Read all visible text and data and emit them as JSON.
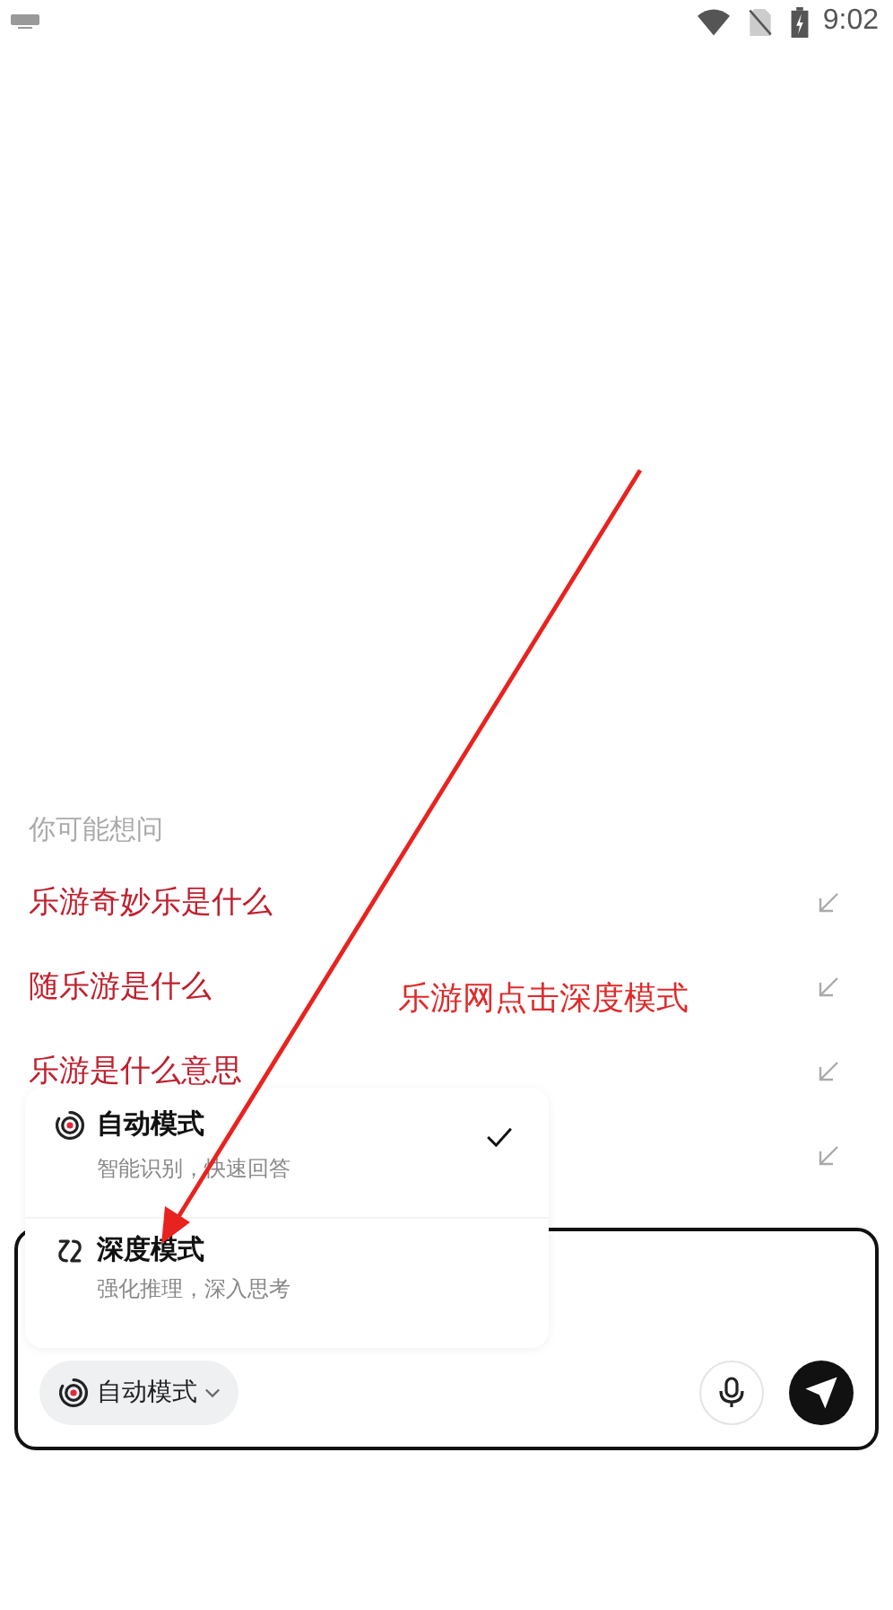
{
  "status_bar": {
    "time": "9:02"
  },
  "suggestions": {
    "title": "你可能想问",
    "items": [
      {
        "text": "乐游奇妙乐是什么"
      },
      {
        "text": "随乐游是什么"
      },
      {
        "text": "乐游是什么意思"
      }
    ]
  },
  "mode_menu": [
    {
      "kind": "auto",
      "label": "自动模式",
      "description": "智能识别，快速回答",
      "selected": true
    },
    {
      "kind": "deep",
      "label": "深度模式",
      "description": "强化推理，深入思考",
      "selected": false
    }
  ],
  "composer": {
    "mode_button": {
      "kind": "auto",
      "label": "自动模式"
    }
  },
  "annotation": {
    "text": "乐游网点击深度模式"
  }
}
